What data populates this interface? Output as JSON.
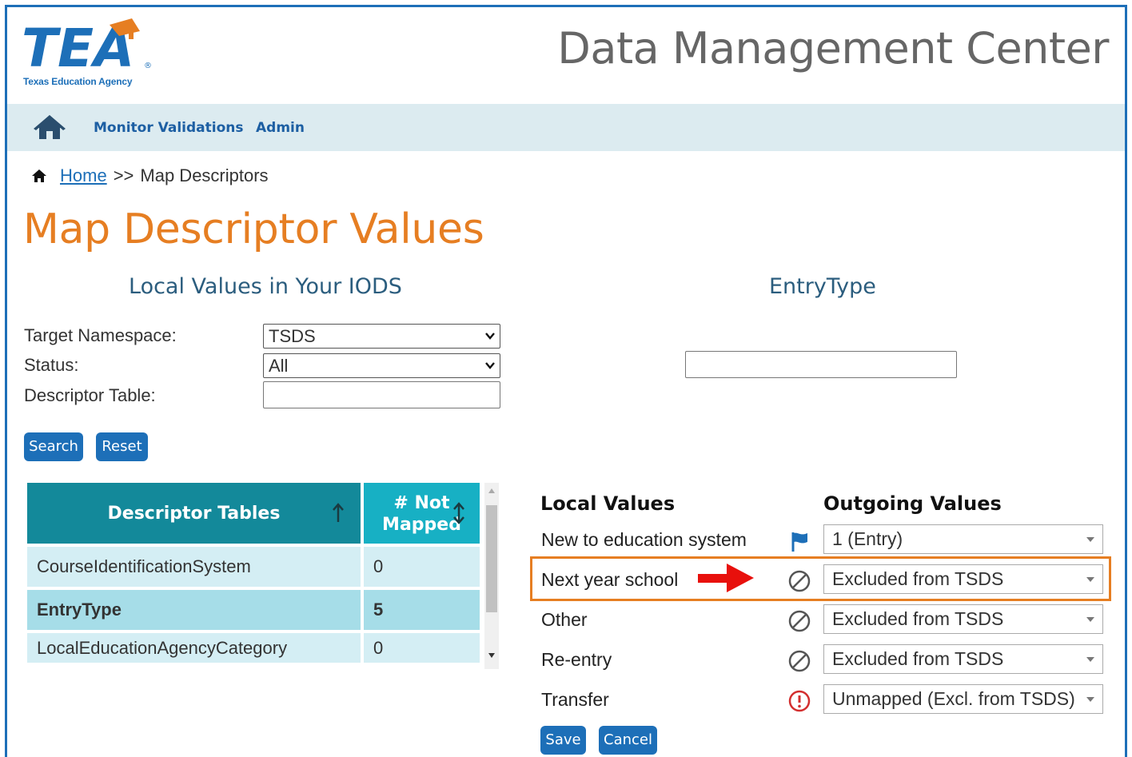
{
  "header": {
    "logo_text": "TEA",
    "logo_subtitle": "Texas Education Agency",
    "app_title": "Data Management Center"
  },
  "nav": {
    "home_icon": "home-icon",
    "items": [
      {
        "label": "Monitor Validations"
      },
      {
        "label": "Admin"
      }
    ]
  },
  "breadcrumb": {
    "home_label": "Home",
    "separator": ">>",
    "current": "Map Descriptors"
  },
  "page_title": "Map Descriptor Values",
  "left_section": {
    "heading": "Local Values in Your IODS",
    "fields": {
      "target_namespace": {
        "label": "Target Namespace:",
        "value": "TSDS"
      },
      "status": {
        "label": "Status:",
        "value": "All"
      },
      "descriptor_table": {
        "label": "Descriptor Table:",
        "value": ""
      }
    },
    "buttons": {
      "search": "Search",
      "reset": "Reset"
    }
  },
  "right_section": {
    "heading": "EntryType",
    "filter_value": ""
  },
  "descriptor_table": {
    "columns": [
      "Descriptor Tables",
      "# Not Mapped"
    ],
    "col2_line1": "# Not",
    "col2_line2": "Mapped",
    "rows": [
      {
        "name": "CourseIdentificationSystem",
        "not_mapped": "0",
        "selected": false
      },
      {
        "name": "EntryType",
        "not_mapped": "5",
        "selected": true
      },
      {
        "name": "LocalEducationAgencyCategory",
        "not_mapped": "0",
        "selected": false
      }
    ]
  },
  "mapping": {
    "local_header": "Local Values",
    "outgoing_header": "Outgoing Values",
    "rows": [
      {
        "local": "New to education system",
        "status_icon": "flag-icon",
        "outgoing": "1 (Entry)"
      },
      {
        "local": "Next year school",
        "status_icon": "excluded-icon",
        "outgoing": "Excluded from TSDS",
        "highlighted": true
      },
      {
        "local": "Other",
        "status_icon": "excluded-icon",
        "outgoing": "Excluded from TSDS"
      },
      {
        "local": "Re-entry",
        "status_icon": "excluded-icon",
        "outgoing": "Excluded from TSDS"
      },
      {
        "local": "Transfer",
        "status_icon": "warning-icon",
        "outgoing": "Unmapped (Excl. from TSDS)"
      }
    ],
    "buttons": {
      "save": "Save",
      "cancel": "Cancel"
    }
  },
  "colors": {
    "brand_blue": "#1d6fb8",
    "accent_orange": "#e67e22",
    "table_header": "#13899a",
    "warning_red": "#d32f2f"
  }
}
